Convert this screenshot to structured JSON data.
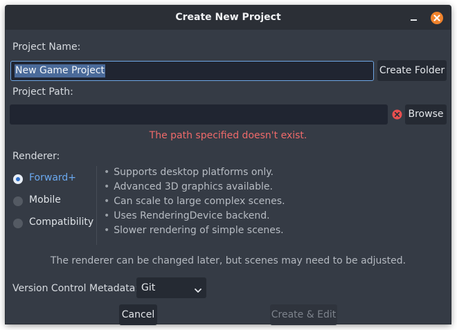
{
  "window": {
    "title": "Create New Project"
  },
  "form": {
    "project_name_label": "Project Name:",
    "project_name_value": "New Game Project",
    "create_folder_label": "Create Folder",
    "project_path_label": "Project Path:",
    "project_path_value": "",
    "browse_label": "Browse",
    "path_error": "The path specified doesn't exist.",
    "renderer_label": "Renderer:",
    "renderers": [
      {
        "label": "Forward+",
        "selected": true
      },
      {
        "label": "Mobile",
        "selected": false
      },
      {
        "label": "Compatibility",
        "selected": false
      }
    ],
    "renderer_info": [
      "Supports desktop platforms only.",
      "Advanced 3D graphics available.",
      "Can scale to large complex scenes.",
      "Uses RenderingDevice backend.",
      "Slower rendering of simple scenes."
    ],
    "renderer_note": "The renderer can be changed later, but scenes may need to be adjusted.",
    "vcs_label": "Version Control Metadata:",
    "vcs_value": "Git"
  },
  "footer": {
    "cancel_label": "Cancel",
    "create_edit_label": "Create & Edit",
    "create_edit_enabled": false
  },
  "icons": {
    "minimize": "minimize-icon",
    "close": "close-icon",
    "error": "error-icon",
    "dropdown": "chevron-down-icon"
  },
  "colors": {
    "accent": "#6aa8ef",
    "error": "#ef6a6a",
    "close_button": "#f0832c",
    "panel": "#353b45"
  }
}
